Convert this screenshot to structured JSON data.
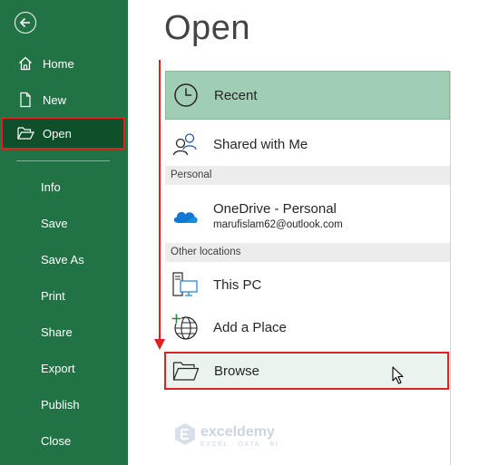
{
  "sidebar": {
    "items": [
      {
        "label": "Home"
      },
      {
        "label": "New"
      },
      {
        "label": "Open"
      },
      {
        "label": "Info"
      },
      {
        "label": "Save"
      },
      {
        "label": "Save As"
      },
      {
        "label": "Print"
      },
      {
        "label": "Share"
      },
      {
        "label": "Export"
      },
      {
        "label": "Publish"
      },
      {
        "label": "Close"
      }
    ]
  },
  "main": {
    "title": "Open",
    "recent_label": "Recent",
    "shared_label": "Shared with Me",
    "personal_header": "Personal",
    "onedrive_label": "OneDrive - Personal",
    "onedrive_email": "marufislam62@outlook.com",
    "other_header": "Other locations",
    "thispc_label": "This PC",
    "addplace_label": "Add a Place",
    "browse_label": "Browse"
  },
  "watermark": {
    "name": "exceldemy",
    "tagline": "EXCEL · DATA · BI"
  },
  "colors": {
    "sidebar_bg": "#217346",
    "active_bg": "#0f4f2a",
    "highlight_red": "#e61e1e",
    "recent_bg": "#a0ceb4"
  }
}
